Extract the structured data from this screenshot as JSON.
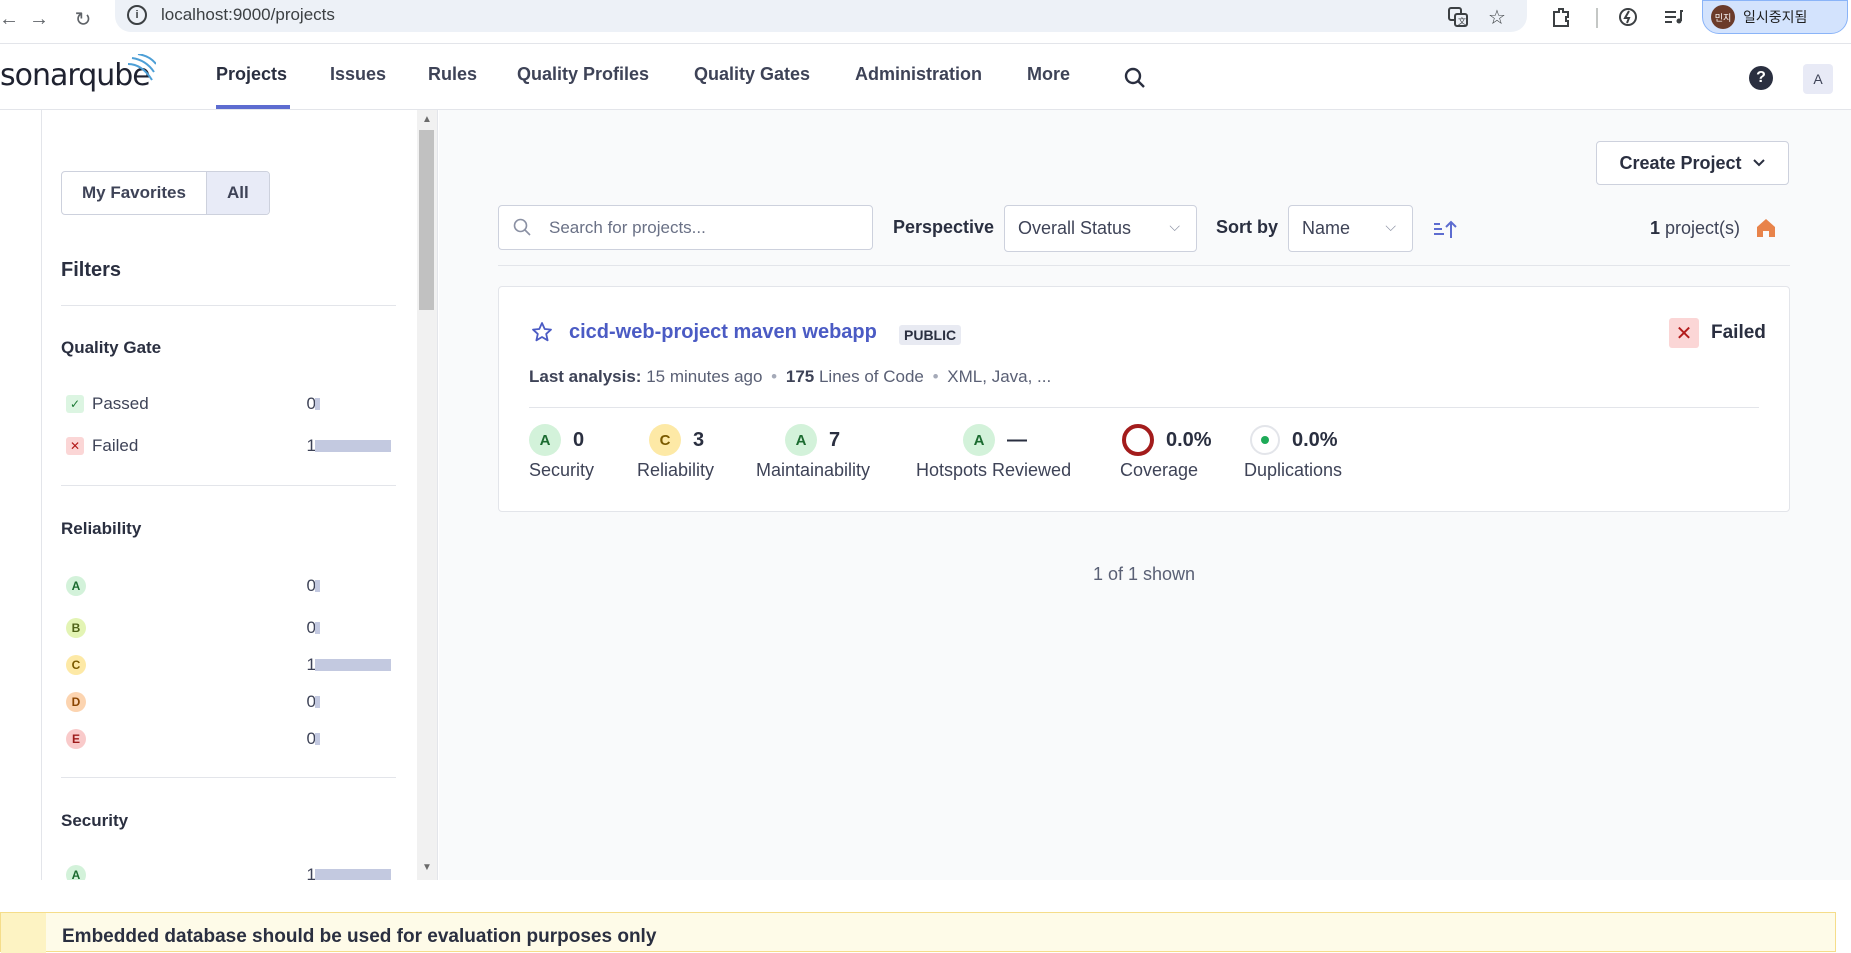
{
  "browser": {
    "url": "localhost:9000/projects",
    "profile_label": "일시중지됨",
    "profile_avatar": "민지"
  },
  "nav": {
    "logo_light": "sonar",
    "logo_bold": "qube",
    "items": [
      "Projects",
      "Issues",
      "Rules",
      "Quality Profiles",
      "Quality Gates",
      "Administration",
      "More"
    ],
    "user_initial": "A",
    "help": "?"
  },
  "sidebar": {
    "toggle": [
      "My Favorites",
      "All"
    ],
    "filters_title": "Filters",
    "quality_gate": {
      "title": "Quality Gate",
      "items": [
        {
          "label": "Passed",
          "count": "0"
        },
        {
          "label": "Failed",
          "count": "1"
        }
      ]
    },
    "reliability": {
      "title": "Reliability",
      "items": [
        {
          "label": "A",
          "count": "0"
        },
        {
          "label": "B",
          "count": "0"
        },
        {
          "label": "C",
          "count": "1"
        },
        {
          "label": "D",
          "count": "0"
        },
        {
          "label": "E",
          "count": "0"
        }
      ]
    },
    "security": {
      "title": "Security",
      "items": [
        {
          "label": "A",
          "count": "1"
        }
      ]
    }
  },
  "main": {
    "create_project": "Create Project",
    "search_placeholder": "Search for projects...",
    "perspective_label": "Perspective",
    "perspective_value": "Overall Status",
    "sort_label": "Sort by",
    "sort_value": "Name",
    "count_number": "1",
    "count_suffix": " project(s)",
    "project": {
      "name": "cicd-web-project maven webapp",
      "visibility": "PUBLIC",
      "status": "Failed",
      "last_analysis_label": "Last analysis:",
      "last_analysis_value": "15 minutes ago",
      "loc_number": "175",
      "loc_suffix": "Lines of Code",
      "languages": "XML, Java, ...",
      "metrics": [
        {
          "rating": "A",
          "value": "0",
          "name": "Security"
        },
        {
          "rating": "C",
          "value": "3",
          "name": "Reliability"
        },
        {
          "rating": "A",
          "value": "7",
          "name": "Maintainability"
        },
        {
          "rating": "A",
          "value": "—",
          "name": "Hotspots Reviewed"
        },
        {
          "value": "0.0%",
          "name": "Coverage"
        },
        {
          "value": "0.0%",
          "name": "Duplications"
        }
      ]
    },
    "shown_text": "1 of 1 shown"
  },
  "banner": {
    "text": "Embedded database should be used for evaluation purposes only"
  },
  "colors": {
    "accent": "#5d6cd0",
    "failed": "#b31b1b",
    "passed": "#1c7a35"
  }
}
